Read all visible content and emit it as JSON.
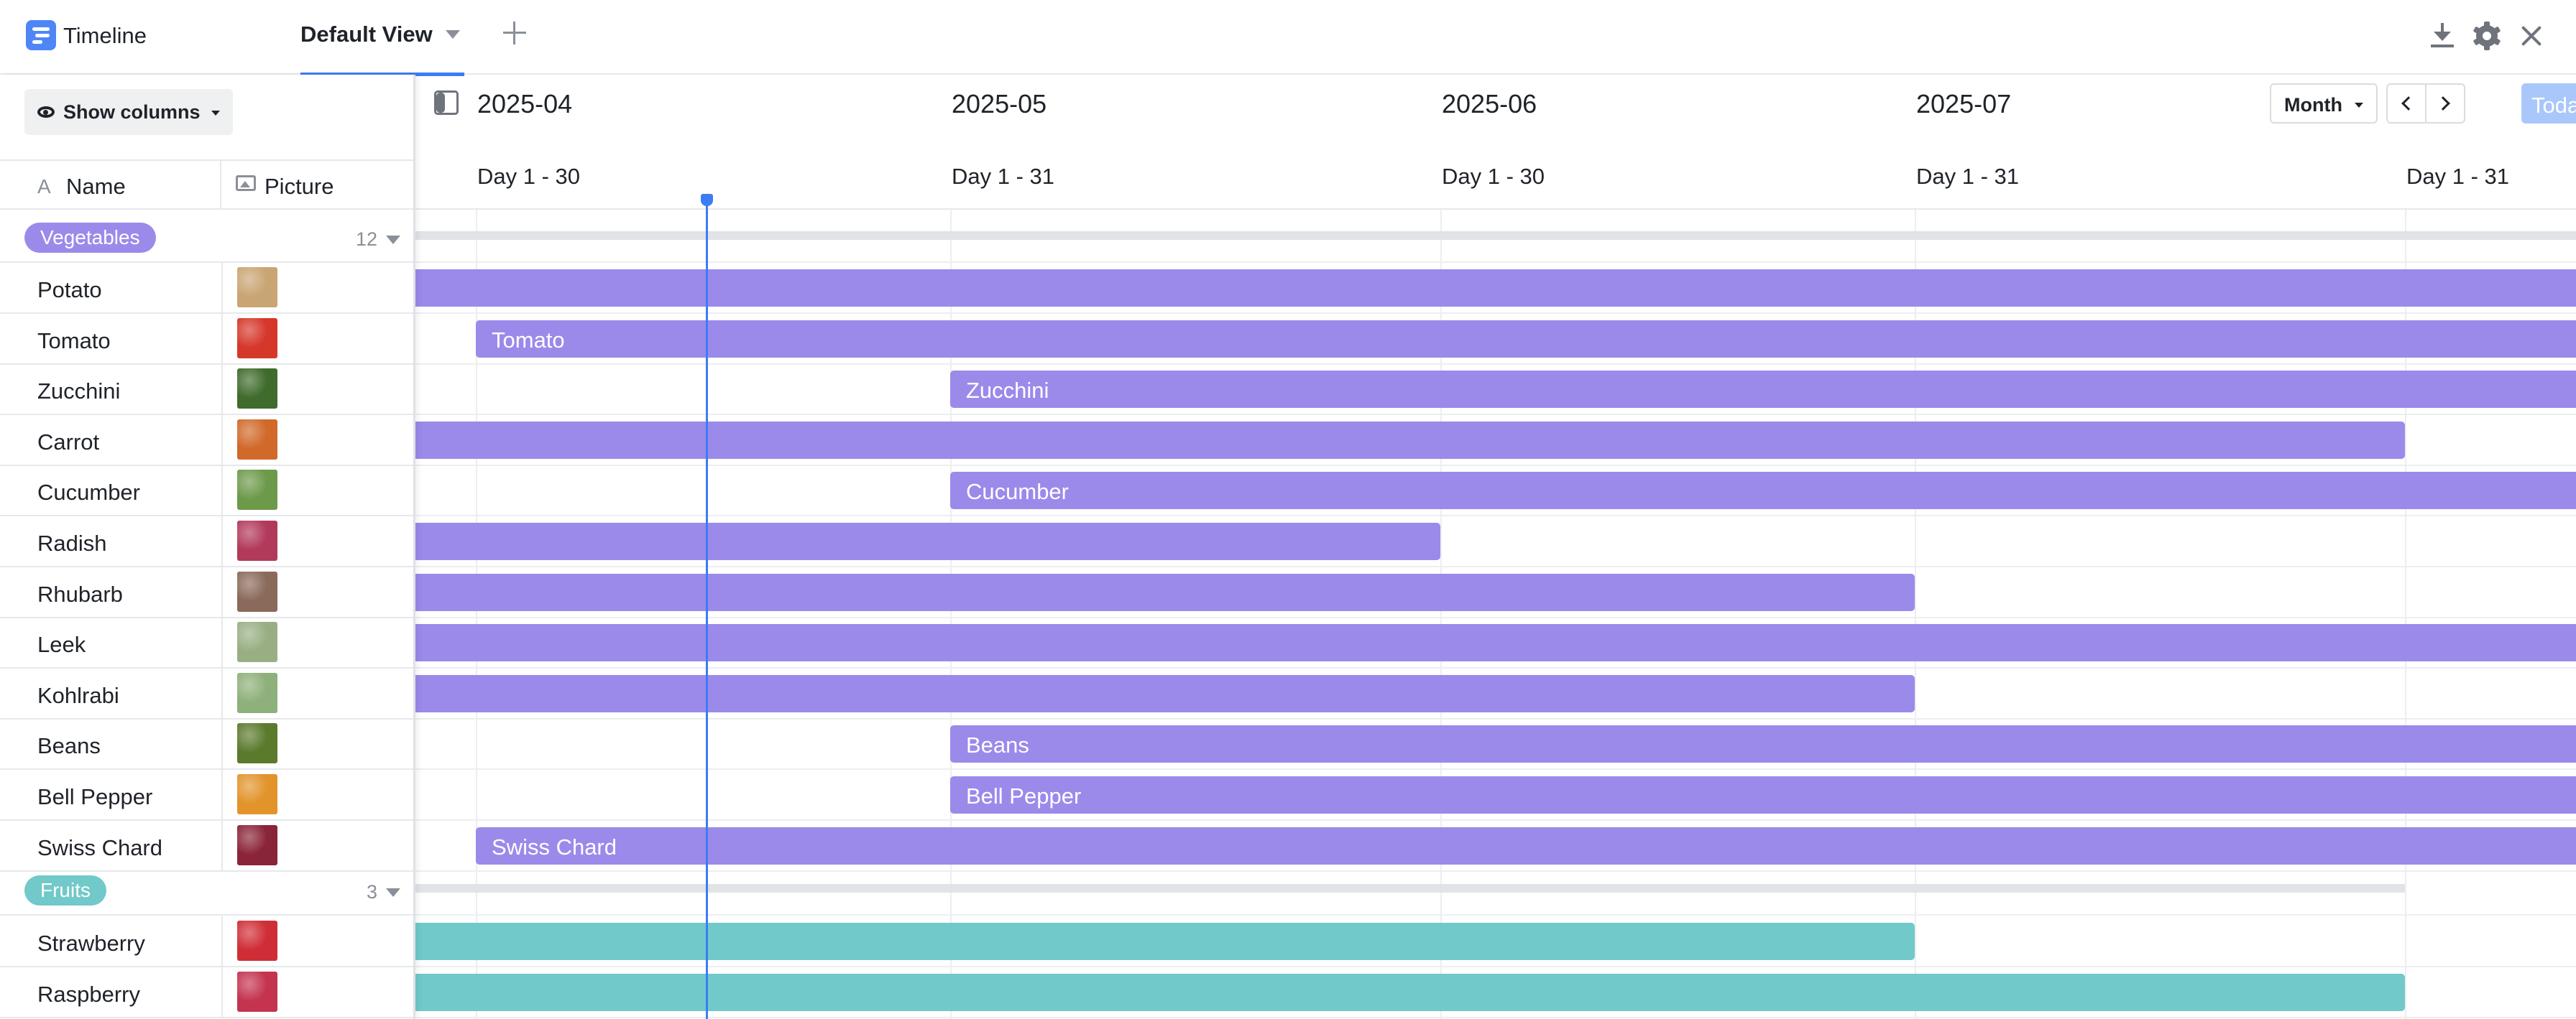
{
  "app": {
    "title": "Timeline"
  },
  "tabs": [
    {
      "label": "Default View",
      "active": true
    }
  ],
  "toolbar": {
    "show_columns_label": "Show columns"
  },
  "columns": {
    "name_label": "Name",
    "picture_label": "Picture"
  },
  "timeline": {
    "months": [
      {
        "label": "2025-04",
        "days": "Day 1 - 30"
      },
      {
        "label": "2025-05",
        "days": "Day 1 - 31"
      },
      {
        "label": "2025-06",
        "days": "Day 1 - 30"
      },
      {
        "label": "2025-07",
        "days": "Day 1 - 31"
      },
      {
        "label": "",
        "days": "Day 1 - 31"
      }
    ],
    "scale_label": "Month",
    "today_label": "Today"
  },
  "groups": [
    {
      "name": "Vegetables",
      "count": "12",
      "color": "#9b8aea",
      "records": [
        {
          "name": "Potato",
          "bar_label": "",
          "thumb": "#c9a574"
        },
        {
          "name": "Tomato",
          "bar_label": "Tomato",
          "thumb": "#d6372b"
        },
        {
          "name": "Zucchini",
          "bar_label": "Zucchini",
          "thumb": "#3f6b2c"
        },
        {
          "name": "Carrot",
          "bar_label": "",
          "thumb": "#d0692a"
        },
        {
          "name": "Cucumber",
          "bar_label": "Cucumber",
          "thumb": "#6d9a4a"
        },
        {
          "name": "Radish",
          "bar_label": "",
          "thumb": "#b13a5a"
        },
        {
          "name": "Rhubarb",
          "bar_label": "",
          "thumb": "#8a6a5a"
        },
        {
          "name": "Leek",
          "bar_label": "",
          "thumb": "#9aae84"
        },
        {
          "name": "Kohlrabi",
          "bar_label": "",
          "thumb": "#8eb07a"
        },
        {
          "name": "Beans",
          "bar_label": "Beans",
          "thumb": "#5a7a2c"
        },
        {
          "name": "Bell Pepper",
          "bar_label": "Bell Pepper",
          "thumb": "#e2942b"
        },
        {
          "name": "Swiss Chard",
          "bar_label": "Swiss Chard",
          "thumb": "#8a2438"
        }
      ]
    },
    {
      "name": "Fruits",
      "count": "3",
      "color": "#71c9c9",
      "records": [
        {
          "name": "Strawberry",
          "bar_label": "",
          "thumb": "#cf2e36"
        },
        {
          "name": "Raspberry",
          "bar_label": "",
          "thumb": "#c4344f"
        }
      ]
    }
  ]
}
